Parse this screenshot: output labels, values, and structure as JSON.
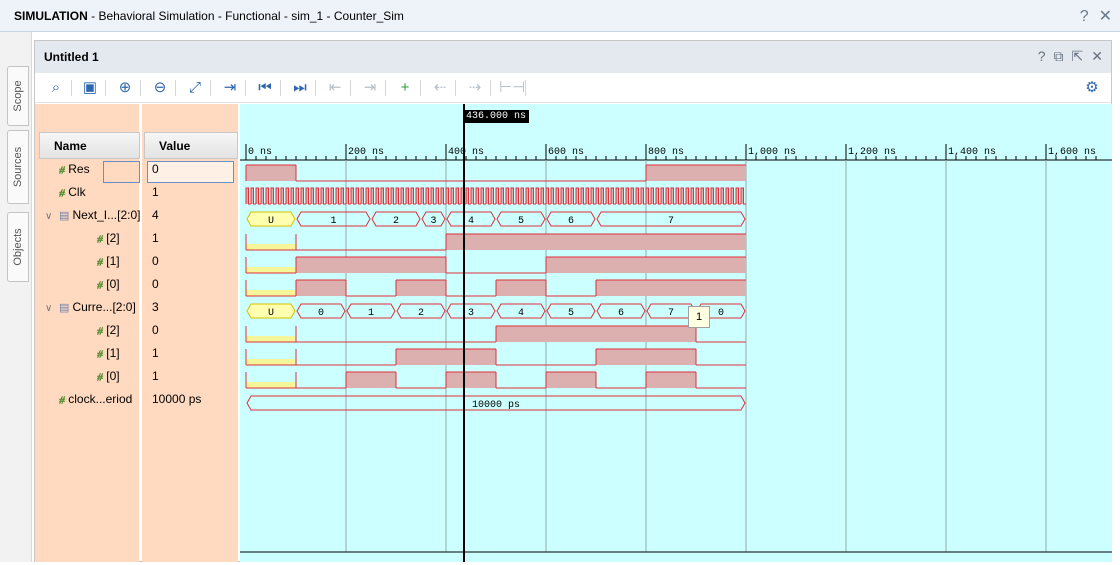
{
  "window": {
    "title_bold": "SIMULATION",
    "title_rest": " - Behavioral Simulation - Functional - sim_1 - Counter_Sim",
    "help": "?",
    "close": "✕"
  },
  "side_tabs": [
    "Scope",
    "Sources",
    "Objects"
  ],
  "panel": {
    "title": "Untitled 1"
  },
  "columns": {
    "name": "Name",
    "value": "Value"
  },
  "signals": [
    {
      "name": "Res",
      "value": "0",
      "kind": "bit",
      "expand": ""
    },
    {
      "name": "Clk",
      "value": "1",
      "kind": "bit",
      "expand": ""
    },
    {
      "name": "Next_I...[2:0]",
      "value": "4",
      "kind": "bus",
      "expand": "∨"
    },
    {
      "name": "[2]",
      "value": "1",
      "kind": "bit",
      "expand": ""
    },
    {
      "name": "[1]",
      "value": "0",
      "kind": "bit",
      "expand": ""
    },
    {
      "name": "[0]",
      "value": "0",
      "kind": "bit",
      "expand": ""
    },
    {
      "name": "Curre...[2:0]",
      "value": "3",
      "kind": "bus",
      "expand": "∨"
    },
    {
      "name": "[2]",
      "value": "0",
      "kind": "bit",
      "expand": ""
    },
    {
      "name": "[1]",
      "value": "1",
      "kind": "bit",
      "expand": ""
    },
    {
      "name": "[0]",
      "value": "1",
      "kind": "bit",
      "expand": ""
    },
    {
      "name": "clock...eriod",
      "value": "10000 ps",
      "kind": "bit",
      "expand": ""
    }
  ],
  "timescale": {
    "labels": [
      "0 ns",
      "200 ns",
      "400 ns",
      "600 ns",
      "800 ns",
      "1,000 ns",
      "1,200 ns",
      "1,400 ns",
      "1,600 ns"
    ]
  },
  "cursor": {
    "label": "436.000 ns",
    "time_ns": 436
  },
  "tooltip": "1",
  "colors": {
    "wave_bg": "#ccffff",
    "name_bg": "#ffdac0",
    "wave": "#e0303a",
    "fill": "#ddb0b0",
    "undef": "#f5f59a"
  },
  "waves": {
    "sim_end_ns": 1000,
    "res": [
      [
        0,
        100,
        1
      ],
      [
        100,
        800,
        0
      ],
      [
        800,
        1000,
        1
      ]
    ],
    "clk_period_ns": 10,
    "next_bus": [
      [
        0,
        100,
        "U"
      ],
      [
        100,
        250,
        "1"
      ],
      [
        250,
        350,
        "2"
      ],
      [
        350,
        400,
        "3"
      ],
      [
        400,
        500,
        "4"
      ],
      [
        500,
        600,
        "5"
      ],
      [
        600,
        700,
        "6"
      ],
      [
        700,
        1000,
        "7"
      ]
    ],
    "next_bits": [
      [
        [
          0,
          100,
          -1
        ],
        [
          100,
          400,
          0
        ],
        [
          400,
          1000,
          1
        ]
      ],
      [
        [
          0,
          100,
          -1
        ],
        [
          100,
          400,
          1
        ],
        [
          400,
          600,
          0
        ],
        [
          600,
          1000,
          1
        ]
      ],
      [
        [
          0,
          100,
          -1
        ],
        [
          100,
          200,
          1
        ],
        [
          200,
          300,
          0
        ],
        [
          300,
          400,
          1
        ],
        [
          400,
          500,
          0
        ],
        [
          500,
          600,
          1
        ],
        [
          600,
          700,
          0
        ],
        [
          700,
          1000,
          1
        ]
      ]
    ],
    "curr_bus": [
      [
        0,
        100,
        "U"
      ],
      [
        100,
        200,
        "0"
      ],
      [
        200,
        300,
        "1"
      ],
      [
        300,
        400,
        "2"
      ],
      [
        400,
        500,
        "3"
      ],
      [
        500,
        600,
        "4"
      ],
      [
        600,
        700,
        "5"
      ],
      [
        700,
        800,
        "6"
      ],
      [
        800,
        900,
        "7"
      ],
      [
        900,
        1000,
        "0"
      ]
    ],
    "curr_bits": [
      [
        [
          0,
          100,
          -1
        ],
        [
          100,
          500,
          0
        ],
        [
          500,
          900,
          1
        ],
        [
          900,
          1000,
          0
        ]
      ],
      [
        [
          0,
          100,
          -1
        ],
        [
          100,
          300,
          0
        ],
        [
          300,
          500,
          1
        ],
        [
          500,
          700,
          0
        ],
        [
          700,
          900,
          1
        ],
        [
          900,
          1000,
          0
        ]
      ],
      [
        [
          0,
          100,
          -1
        ],
        [
          100,
          200,
          0
        ],
        [
          200,
          300,
          1
        ],
        [
          300,
          400,
          0
        ],
        [
          400,
          500,
          1
        ],
        [
          500,
          600,
          0
        ],
        [
          600,
          700,
          1
        ],
        [
          700,
          800,
          0
        ],
        [
          800,
          900,
          1
        ],
        [
          900,
          1000,
          0
        ]
      ]
    ],
    "period_label": "10000 ps"
  }
}
